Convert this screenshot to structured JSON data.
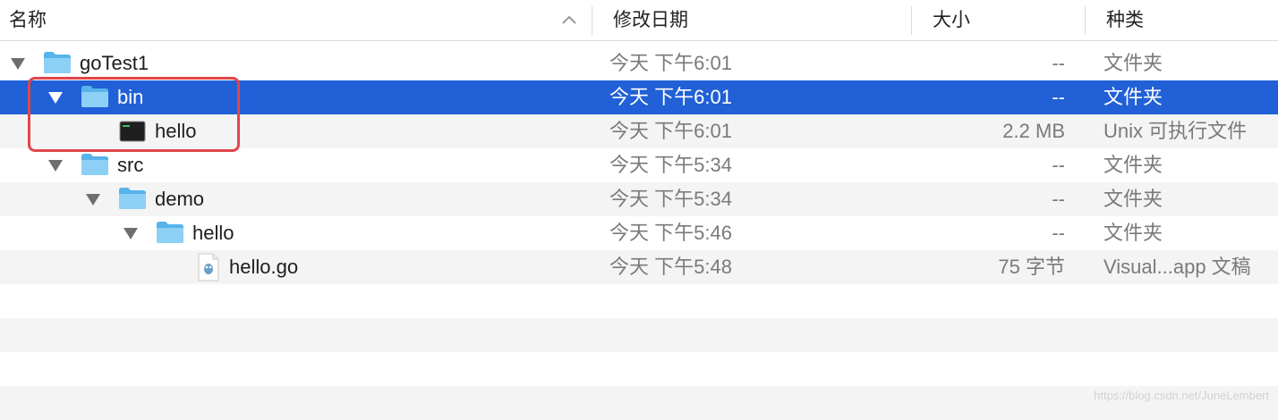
{
  "columns": {
    "name": "名称",
    "modified": "修改日期",
    "size": "大小",
    "kind": "种类"
  },
  "rows": [
    {
      "name": "goTest1",
      "date": "今天 下午6:01",
      "size": "--",
      "kind": "文件夹",
      "icon": "folder-icon",
      "expanded": true,
      "level": 0
    },
    {
      "name": "bin",
      "date": "今天 下午6:01",
      "size": "--",
      "kind": "文件夹",
      "icon": "folder-icon",
      "expanded": true,
      "level": 1,
      "selected": true
    },
    {
      "name": "hello",
      "date": "今天 下午6:01",
      "size": "2.2 MB",
      "kind": "Unix 可执行文件",
      "icon": "terminal-executable-icon",
      "level": 2
    },
    {
      "name": "src",
      "date": "今天 下午5:34",
      "size": "--",
      "kind": "文件夹",
      "icon": "folder-icon",
      "expanded": true,
      "level": 1
    },
    {
      "name": "demo",
      "date": "今天 下午5:34",
      "size": "--",
      "kind": "文件夹",
      "icon": "folder-icon",
      "expanded": true,
      "level": 2
    },
    {
      "name": "hello",
      "date": "今天 下午5:46",
      "size": "--",
      "kind": "文件夹",
      "icon": "folder-icon",
      "expanded": true,
      "level": 3
    },
    {
      "name": "hello.go",
      "date": "今天 下午5:48",
      "size": "75 字节",
      "kind": "Visual...app 文稿",
      "icon": "go-document-icon",
      "level": 4
    }
  ],
  "watermark": "https://blog.csdn.net/JuneLembert",
  "colors": {
    "selection": "#2160d6",
    "folder": "#6cc0f0",
    "highlight_box": "#e0464b",
    "alt_row": "#f4f4f5"
  }
}
